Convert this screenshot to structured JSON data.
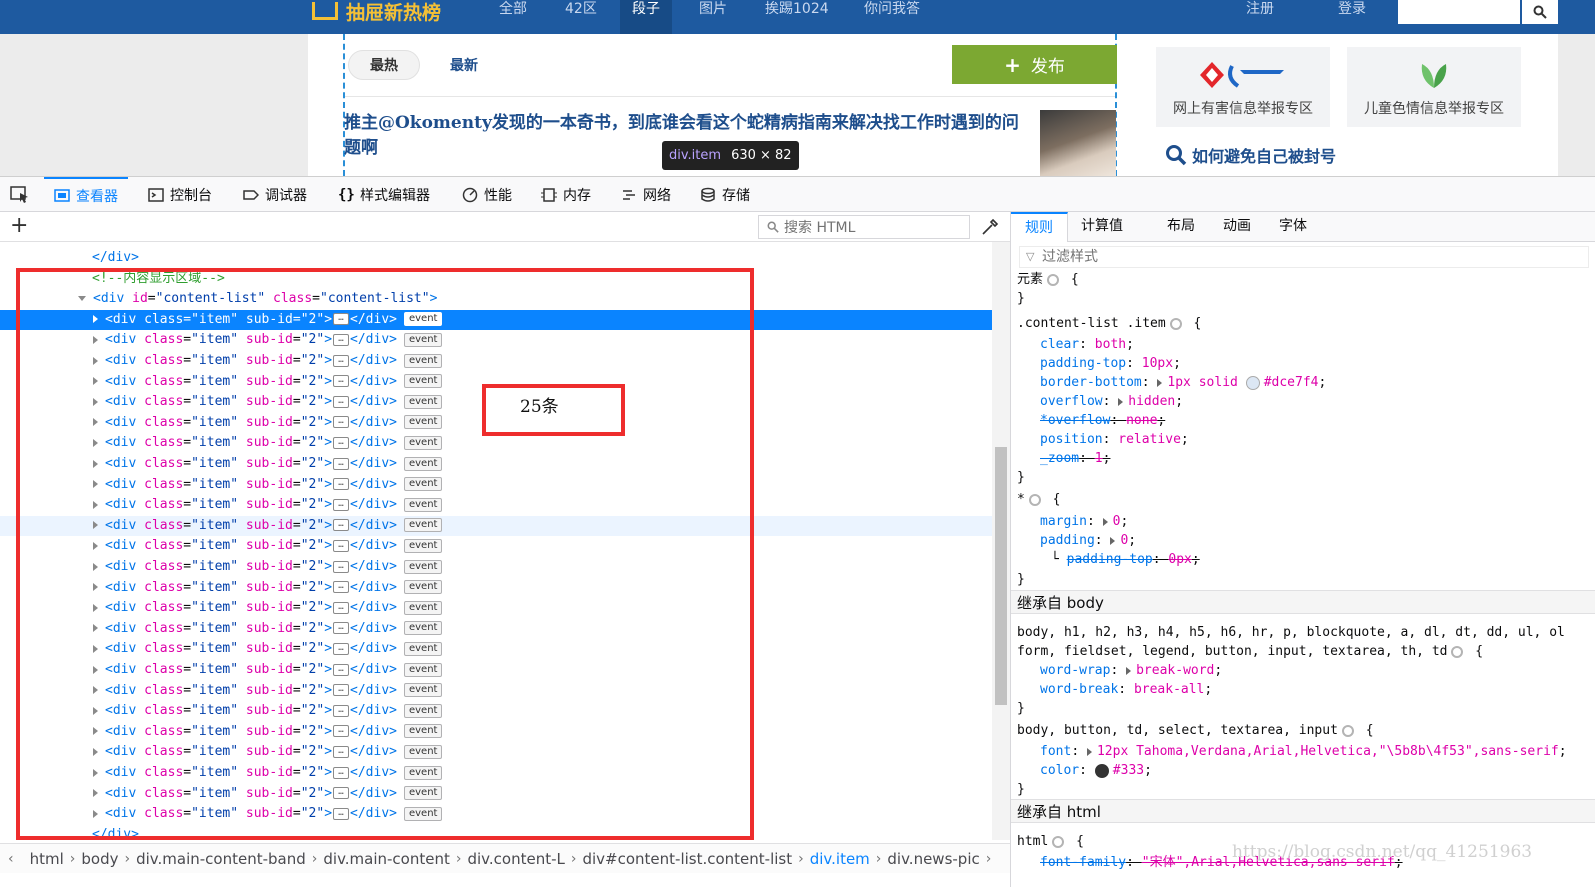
{
  "site": {
    "logo_text": "抽屉新热榜",
    "nav": [
      "全部",
      "42区",
      "段子",
      "图片",
      "挨踢1024",
      "你问我答"
    ],
    "active_nav": "段子",
    "register": "注册",
    "login": "登录",
    "tab_hot": "最热",
    "tab_new": "最新",
    "publish": "发布",
    "article_title": "推主@Okomenty发现的一本奇书，到底谁会看这个蛇精病指南来解决找工作时遇到的问题啊",
    "tooltip_tag": "div.item",
    "tooltip_size": "630 × 82",
    "report_cards": [
      "网上有害信息举报专区",
      "儿童色情信息举报专区"
    ],
    "avoid_ban": "如何避免自己被封号",
    "colors": {
      "nav_bg": "#1e5aa0",
      "publish_bg": "#7ca832",
      "logo": "#f4c036"
    }
  },
  "devtools": {
    "tabs": [
      {
        "label": "查看器",
        "icon": "inspector-icon"
      },
      {
        "label": "控制台",
        "icon": "console-icon"
      },
      {
        "label": "调试器",
        "icon": "debugger-icon"
      },
      {
        "label": "样式编辑器",
        "icon": "style-editor-icon"
      },
      {
        "label": "性能",
        "icon": "performance-icon"
      },
      {
        "label": "内存",
        "icon": "memory-icon"
      },
      {
        "label": "网络",
        "icon": "network-icon"
      },
      {
        "label": "存储",
        "icon": "storage-icon"
      }
    ],
    "search_placeholder": "搜索 HTML",
    "markup": {
      "close_div_top": "</div>",
      "comment": "<!--内容显示区域-->",
      "parent_tag": "div",
      "parent_attrs": [
        [
          "id",
          "content-list"
        ],
        [
          "class",
          "content-list"
        ]
      ],
      "child_tag": "div",
      "child_attrs": [
        [
          "class",
          "item"
        ],
        [
          "sub-id",
          "2"
        ]
      ],
      "child_count_visible": 25,
      "event_badge": "event",
      "close_div_bottom": "</div>"
    },
    "annotation": "25条",
    "breadcrumbs": [
      "html",
      "body",
      "div.main-content-band",
      "div.main-content",
      "div.content-L",
      "div#content-list.content-list",
      "div.item",
      "div.news-pic"
    ],
    "current_crumb": "div.item",
    "rules_tabs": [
      "规则",
      "计算值",
      "布局",
      "动画",
      "字体"
    ],
    "filter_placeholder": "过滤样式",
    "rules": {
      "element_selector": "元素",
      "item_selector": ".content-list .item",
      "item_props": [
        [
          "clear",
          "both",
          false
        ],
        [
          "padding-top",
          "10px",
          false
        ],
        [
          "border-bottom",
          "1px solid #dce7f4",
          false
        ],
        [
          "overflow",
          "hidden",
          false
        ],
        [
          "*overflow",
          "none",
          true
        ],
        [
          "position",
          "relative",
          false
        ],
        [
          "_zoom",
          "1",
          true
        ]
      ],
      "star_selector": "*",
      "star_props": [
        [
          "margin",
          "0",
          false
        ],
        [
          "padding",
          "0",
          false
        ]
      ],
      "star_sub": [
        "padding-top",
        "0px"
      ],
      "inherit_body": "继承自 body",
      "body_selector_1": "body, h1, h2, h3, h4, h5, h6, hr, p, blockquote, a, dl, dt, dd, ul, ol",
      "body_selector_2": "form, fieldset, legend, button, input, textarea, th, td",
      "body_props": [
        [
          "word-wrap",
          "break-word"
        ],
        [
          "word-break",
          "break-all"
        ]
      ],
      "body2_selector": "body, button, td, select, textarea, input",
      "body2_props": [
        [
          "font",
          "12px Tahoma,Verdana,Arial,Helvetica,\"\\5b8b\\4f53\",sans-serif"
        ],
        [
          "color",
          "#333"
        ]
      ],
      "inherit_html": "继承自 html",
      "html_selector": "html",
      "html_props": [
        [
          "font-family",
          "\"宋体\",Arial,Helvetica,sans-serif"
        ]
      ]
    },
    "watermark": "https://blog.csdn.net/qq_41251963"
  }
}
